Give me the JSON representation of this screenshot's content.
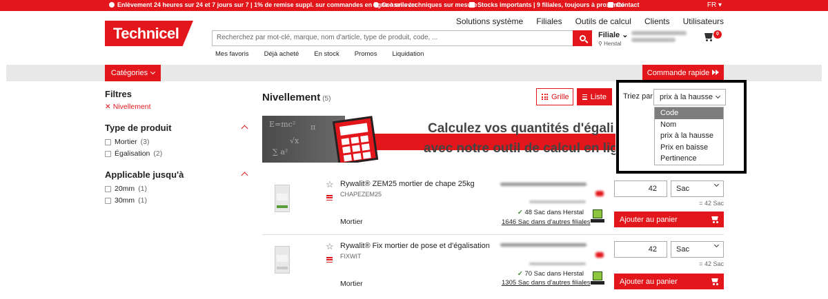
{
  "topbar": {
    "msg1": "Enlèvement 24 heures sur 24 et 7 jours sur 7 | 1% de remise suppl. sur commandes en ligne à enlever",
    "msg2": "Conseils techniques sur mesure",
    "msg3": "Stocks importants | 9 filiales, toujours à proximité",
    "msg4": "Contact",
    "lang": "FR ▾"
  },
  "logo": {
    "text": "Technicel"
  },
  "topnav": [
    "Solutions système",
    "Filiales",
    "Outils de calcul",
    "Clients",
    "Utilisateurs"
  ],
  "search": {
    "placeholder": "Recherchez par mot-clé, marque, nom d'article, type de produit, code, ..."
  },
  "subnav": [
    "Mes favoris",
    "Déjà acheté",
    "En stock",
    "Promos",
    "Liquidation"
  ],
  "filiale": {
    "label": "Filiale",
    "location": "Herstal"
  },
  "cart": {
    "count": "0"
  },
  "categories_button": "Catégories",
  "quick_order_button": "Commande rapide",
  "filters": {
    "title": "Filtres",
    "active": "✕ Nivellement",
    "groups": [
      {
        "title": "Type de produit",
        "items": [
          {
            "label": "Mortier",
            "count": "(3)"
          },
          {
            "label": "Égalisation",
            "count": "(2)"
          }
        ]
      },
      {
        "title": "Applicable jusqu'à",
        "items": [
          {
            "label": "20mm",
            "count": "(1)"
          },
          {
            "label": "30mm",
            "count": "(1)"
          }
        ]
      }
    ]
  },
  "main": {
    "title": "Nivellement",
    "count": "(5)",
    "grid_label": "Grille",
    "list_label": "Liste",
    "sort_label": "Triez par",
    "sort_selected": "prix à la hausse",
    "sort_options": [
      "Code",
      "Nom",
      "prix à la hausse",
      "Prix en baisse",
      "Pertinence"
    ],
    "sort_highlighted": "Code"
  },
  "banner": {
    "line1": "Calculez vos quantités d'égali",
    "line2": "avec notre outil de calcul en lig"
  },
  "products": [
    {
      "name": "Rywalit® ZEM25 mortier de chape 25kg",
      "code": "CHAPEZEM25",
      "category": "Mortier",
      "stock_local": "48 Sac dans Herstal",
      "stock_other": "1646 Sac dans d'autres filiales",
      "qty": "42",
      "unit": "Sac",
      "equiv": "= 42 Sac",
      "add_label": "Ajouter au panier"
    },
    {
      "name": "Rywalit® Fix mortier de pose et d'égalisation",
      "code": "FIXWIT",
      "category": "Mortier",
      "stock_local": "70 Sac dans Herstal",
      "stock_other": "1305 Sac dans d'autres filiales",
      "qty": "42",
      "unit": "Sac",
      "equiv": "= 42 Sac",
      "add_label": "Ajouter au panier"
    }
  ],
  "colors": {
    "brand": "#e3161b",
    "stock_ok": "#3a8a2a"
  }
}
